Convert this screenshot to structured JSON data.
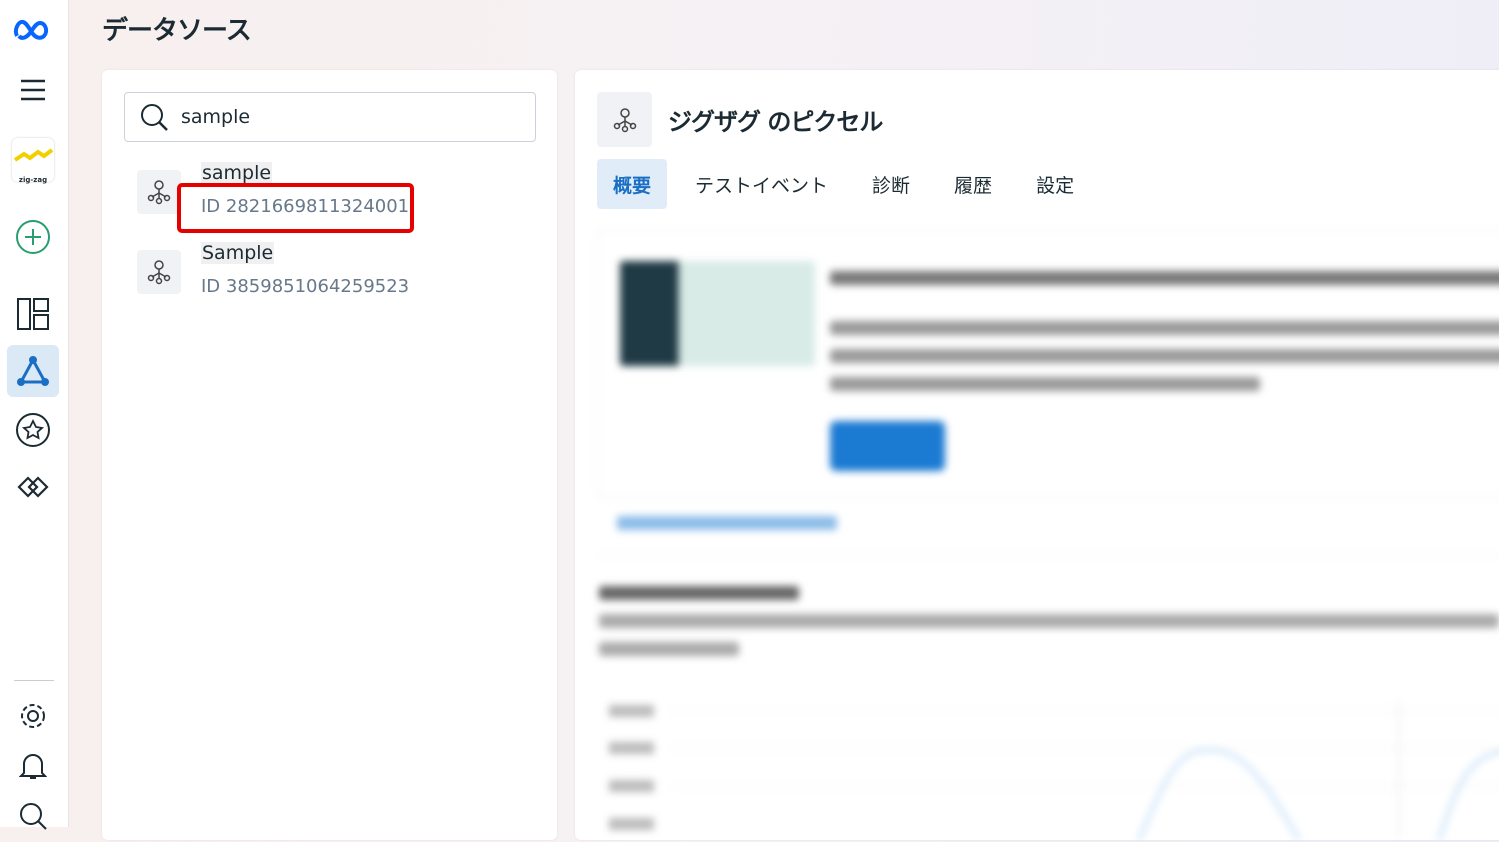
{
  "page": {
    "title": "データソース"
  },
  "search": {
    "value": "sample"
  },
  "sources": [
    {
      "name": "sample",
      "id": "ID 2821669811324001",
      "highlighted": true
    },
    {
      "name": "Sample",
      "id": "ID 3859851064259523",
      "highlighted": false
    }
  ],
  "detail": {
    "title": "ジグザグ のピクセル",
    "tabs": [
      {
        "label": "概要",
        "active": true
      },
      {
        "label": "テストイベント"
      },
      {
        "label": "診断"
      },
      {
        "label": "履歴"
      },
      {
        "label": "設定"
      }
    ]
  },
  "colors": {
    "accent": "#1a6fc4",
    "highlight": "#e60000",
    "brand": "#0866ff"
  }
}
